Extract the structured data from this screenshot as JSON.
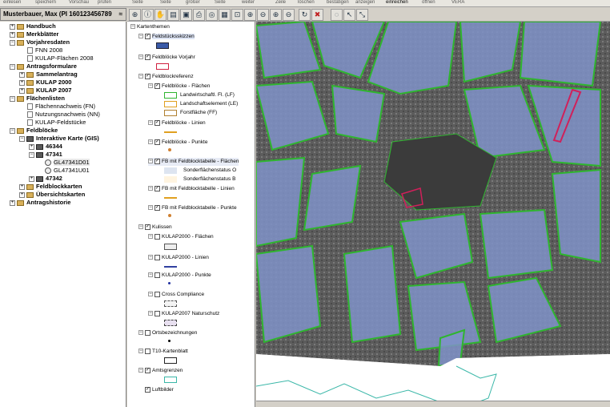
{
  "top_toolbar": {
    "items": [
      "einlesen",
      "speichern",
      "Vorschau",
      "prüfen",
      "Seite",
      "Seite",
      "größer",
      "Seite",
      "weiter",
      "Zeile",
      "löschen",
      "bestätigen",
      "anzeigen",
      "einreichen",
      "öffnen",
      "VERA"
    ]
  },
  "user": {
    "label": "Musterbauer, Max  (PI 160123456789",
    "caret": "≈"
  },
  "tree": [
    {
      "label": "Handbuch",
      "bold": true
    },
    {
      "label": "Merkblätter",
      "bold": true
    },
    {
      "label": "Vorjahresdaten",
      "bold": true
    },
    {
      "label": "FNN 2008",
      "bold": false
    },
    {
      "label": "KULAP-Flächen 2008",
      "bold": false
    },
    {
      "label": "Antragsformulare",
      "bold": true
    },
    {
      "label": "Sammelantrag",
      "bold": true
    },
    {
      "label": "KULAP 2000",
      "bold": true
    },
    {
      "label": "KULAP 2007",
      "bold": true
    },
    {
      "label": "Flächenlisten",
      "bold": true
    },
    {
      "label": "Flächennachweis (FN)",
      "bold": false
    },
    {
      "label": "Nutzungsnachweis (NN)",
      "bold": false
    },
    {
      "label": "KULAP-Feldstücke",
      "bold": false
    },
    {
      "label": "Feldblöcke",
      "bold": true
    },
    {
      "label": "Interaktive Karte (GIS)",
      "bold": true
    },
    {
      "label": "46344",
      "bold": true
    },
    {
      "label": "47341",
      "bold": true
    },
    {
      "label": "GL47341D01",
      "bold": false
    },
    {
      "label": "GL47341U01",
      "bold": false
    },
    {
      "label": "47342",
      "bold": true
    },
    {
      "label": "Feldblockkarten",
      "bold": true
    },
    {
      "label": "Übersichtskarten",
      "bold": true
    },
    {
      "label": "Antragshistorie",
      "bold": true
    }
  ],
  "layers": {
    "root": "Kartenthemen",
    "feldstueckskizzen": "Feldstücksskizzen",
    "feldbloecke_vorjahr": "Feldblöcke Vorjahr",
    "feldblockreferenz": "Feldblockreferenz",
    "fb_flaechen": "Feldblöcke - Flächen",
    "lf": "Landwirtschaftl. Fl. (LF)",
    "le": "Landschaftselement (LE)",
    "ff": "Forstfläche (FF)",
    "fb_linien": "Feldblöcke - Linien",
    "fb_punkte": "Feldblöcke - Punkte",
    "fbt_flaechen": "FB mit Feldblocktabelle - Flächen",
    "sonder_o": "Sonderflächenstatus O",
    "sonder_b": "Sonderflächenstatus B",
    "fbt_linien": "FB mit Feldblocktabelle - Linien",
    "fbt_punkte": "FB mit Feldblocktabelle - Punkte",
    "kulissen": "Kulissen",
    "k2000_fl": "KULAP2000 - Flächen",
    "k2000_li": "KULAP2000 - Linien",
    "k2000_pu": "KULAP2000 - Punkte",
    "cc": "Cross Compliance",
    "k2007_ns": "KULAP2007 Naturschutz",
    "orts": "Ortsbezeichnungen",
    "t10": "T10-Kartenblatt",
    "amts": "Amtsgrenzen",
    "luft": "Luftbilder"
  },
  "toolbar_icons": [
    "target-icon",
    "info-icon",
    "hand-icon",
    "layers-icon",
    "save-map-icon",
    "print-icon",
    "globe-icon",
    "map-icon",
    "select-icon",
    "zoom-in-icon",
    "zoom-out-icon",
    "zoom-in-box-icon",
    "zoom-out-box-icon",
    "refresh-icon",
    "stop-icon",
    "lasso-icon",
    "pointer-icon",
    "measure-icon"
  ],
  "colors": {
    "field_green": "#2fb52f",
    "field_fill": "#7f92c8",
    "lf": "#2fb52f",
    "le": "#e0a020",
    "ff": "#b08030",
    "highlight_red": "#d0205a",
    "amts_cyan": "#3ab7a8"
  }
}
